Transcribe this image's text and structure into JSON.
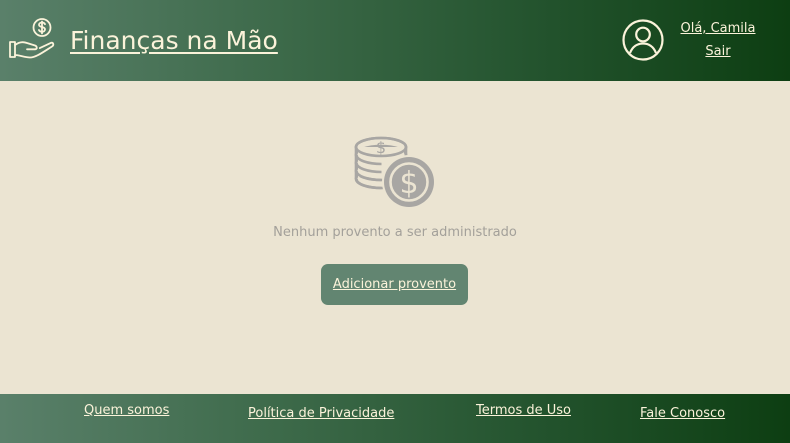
{
  "header": {
    "title": "Finanças na Mão",
    "brand_icon": "hand-holding-dollar-icon",
    "user_icon": "user-circle-icon",
    "greeting": "Olá, Camila",
    "logout_label": "Sair"
  },
  "main": {
    "empty_icon": "coins-dollar-icon",
    "empty_message": "Nenhum provento a ser administrado",
    "add_button_label": "Adicionar provento"
  },
  "footer": {
    "links": [
      {
        "label": "Quem somos"
      },
      {
        "label": "Política de Privacidade"
      },
      {
        "label": "Termos de Uso"
      },
      {
        "label": "Fale Conosco"
      }
    ]
  },
  "colors": {
    "header_gradient_start": "#5a806a",
    "header_gradient_end": "#0d3e12",
    "background": "#ebe4d2",
    "header_text": "#fbf3da",
    "button": "#628571",
    "muted_text": "#a3a09a",
    "icon_gray": "#a8a6a3"
  }
}
